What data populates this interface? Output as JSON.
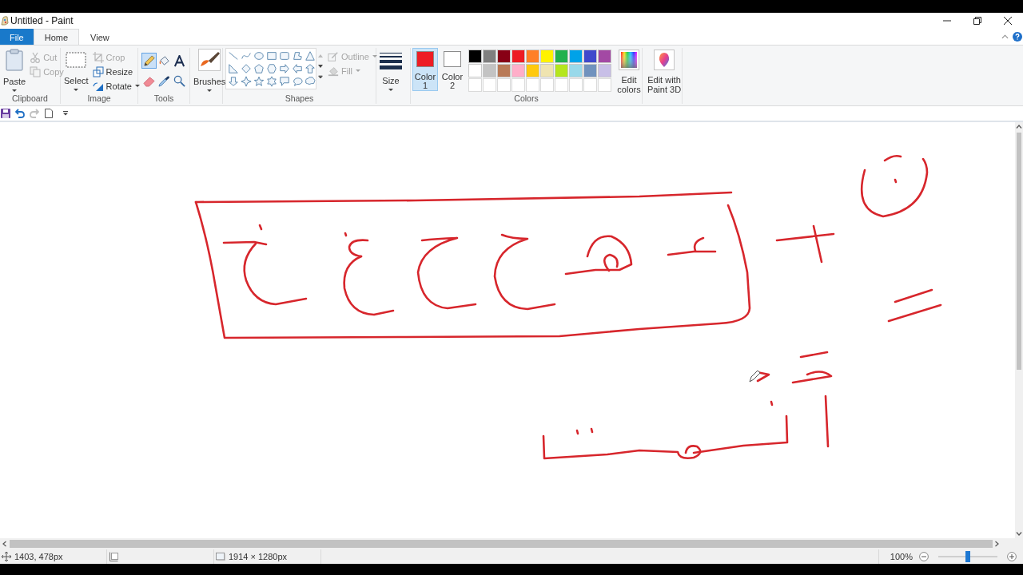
{
  "window": {
    "title": "Untitled - Paint"
  },
  "ribbon_tabs": [
    {
      "label": "File",
      "kind": "menu",
      "selected": false
    },
    {
      "label": "Home",
      "kind": "tab",
      "selected": true
    },
    {
      "label": "View",
      "kind": "tab",
      "selected": false
    }
  ],
  "clipboard": {
    "label": "Clipboard",
    "paste": "Paste",
    "actions": [
      {
        "label": "Cut",
        "disabled": true
      },
      {
        "label": "Copy",
        "disabled": true
      }
    ]
  },
  "image": {
    "label": "Image",
    "select": "Select",
    "actions": [
      {
        "label": "Crop",
        "disabled": true
      },
      {
        "label": "Resize",
        "disabled": false
      },
      {
        "label": "Rotate",
        "disabled": false
      }
    ]
  },
  "tools": {
    "label": "Tools",
    "items": [
      {
        "selected": true
      },
      {
        "selected": false
      },
      {
        "selected": false
      },
      {
        "selected": false
      },
      {
        "selected": false
      },
      {
        "selected": false
      }
    ]
  },
  "brushes": {
    "label": "Brushes"
  },
  "shapes": {
    "label": "Shapes",
    "options": [
      {
        "label": "Outline",
        "disabled": true
      },
      {
        "label": "Fill",
        "disabled": true
      }
    ]
  },
  "size": {
    "label": "Size"
  },
  "colors": {
    "label": "Colors",
    "current": [
      {
        "label": "Color 1",
        "color": "#ed1c24",
        "selected": true
      },
      {
        "label": "Color 2",
        "color": "#ffffff",
        "selected": false
      }
    ],
    "palette": [
      {
        "kind": "swatch",
        "color": "#000000"
      },
      {
        "kind": "swatch",
        "color": "#7f7f7f"
      },
      {
        "kind": "swatch",
        "color": "#880015"
      },
      {
        "kind": "swatch",
        "color": "#ed1c24"
      },
      {
        "kind": "swatch",
        "color": "#ff7f27"
      },
      {
        "kind": "swatch",
        "color": "#fff200"
      },
      {
        "kind": "swatch",
        "color": "#22b14c"
      },
      {
        "kind": "swatch",
        "color": "#00a2e8"
      },
      {
        "kind": "swatch",
        "color": "#3f48cc"
      },
      {
        "kind": "swatch",
        "color": "#a349a4"
      },
      {
        "kind": "swatch",
        "color": "#ffffff"
      },
      {
        "kind": "swatch",
        "color": "#c3c3c3"
      },
      {
        "kind": "swatch",
        "color": "#b97a57"
      },
      {
        "kind": "swatch",
        "color": "#ffaec9"
      },
      {
        "kind": "swatch",
        "color": "#ffc90e"
      },
      {
        "kind": "swatch",
        "color": "#efe4b0"
      },
      {
        "kind": "swatch",
        "color": "#b5e61d"
      },
      {
        "kind": "swatch",
        "color": "#99d9ea"
      },
      {
        "kind": "swatch",
        "color": "#7092be"
      },
      {
        "kind": "swatch",
        "color": "#c8bfe7"
      },
      {
        "kind": "empty"
      },
      {
        "kind": "empty"
      },
      {
        "kind": "empty"
      },
      {
        "kind": "empty"
      },
      {
        "kind": "empty"
      },
      {
        "kind": "empty"
      },
      {
        "kind": "empty"
      },
      {
        "kind": "empty"
      },
      {
        "kind": "empty"
      },
      {
        "kind": "empty"
      }
    ],
    "edit": "Edit colors"
  },
  "paint3d": {
    "label": "Edit with Paint 3D"
  },
  "quick_access": [
    {
      "disabled": false
    },
    {
      "disabled": false
    },
    {
      "disabled": true
    },
    {
      "disabled": false
    }
  ],
  "status_bar": {
    "position": "1403, 478px",
    "canvas_size": "1914 × 1280px",
    "zoom": {
      "label": "100%",
      "level": 0.5
    }
  }
}
